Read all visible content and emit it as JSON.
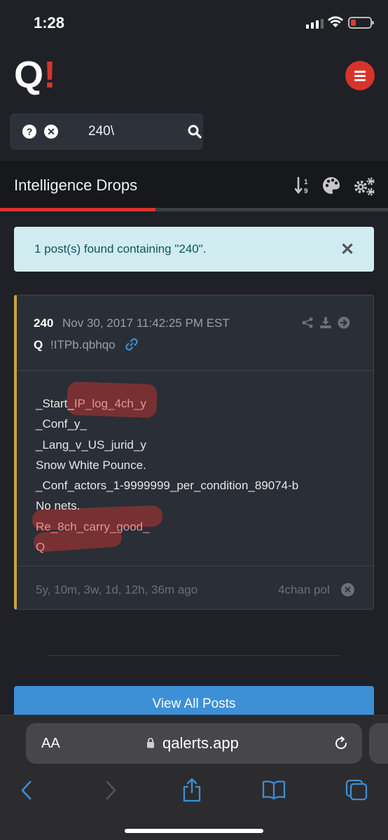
{
  "status_bar": {
    "time": "1:28"
  },
  "header": {
    "logo_q": "Q",
    "logo_bang": "!"
  },
  "search": {
    "query": "240\\"
  },
  "section": {
    "title": "Intelligence Drops",
    "progress_fraction": 0.4
  },
  "alert": {
    "message": "1 post(s) found containing \"240\".",
    "close": "✕"
  },
  "post": {
    "number": "240",
    "date": "Nov 30, 2017 11:42:25 PM EST",
    "author": "Q",
    "tripcode": "!ITPb.qbhqo",
    "lines": [
      "_Start_IP_log_4ch_y",
      "_Conf_y_",
      "_Lang_v_US_jurid_y",
      "Snow White Pounce.",
      "_Conf_actors_1-9999999_per_condition_89074-b",
      "No nets.",
      "Re_8ch_carry_good_",
      "Q"
    ],
    "time_ago": "5y, 10m, 3w, 1d, 12h, 36m ago",
    "board": "4chan pol"
  },
  "view_all_label": "View All Posts",
  "browser": {
    "aa_label": "AA",
    "host": "qalerts.app"
  },
  "colors": {
    "accent_red": "#d6342b",
    "accent_blue": "#3d8fd6",
    "card_border_gold": "#c7a43c",
    "alert_bg": "#d1ecf1"
  }
}
